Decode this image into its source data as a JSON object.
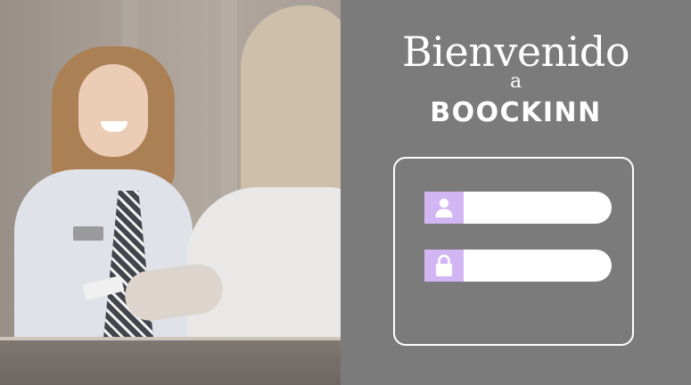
{
  "welcome": {
    "title": "Bienvenido",
    "connector": "a",
    "brand": "BOOCKINN"
  },
  "login": {
    "username_placeholder": "",
    "username_value": "",
    "password_placeholder": "",
    "password_value": "",
    "username_icon": "user-icon",
    "password_icon": "lock-icon"
  },
  "colors": {
    "panel_background": "#7b7b7b",
    "accent_icon_background": "#d2b6f3",
    "text": "#ffffff",
    "field_background": "#ffffff"
  }
}
